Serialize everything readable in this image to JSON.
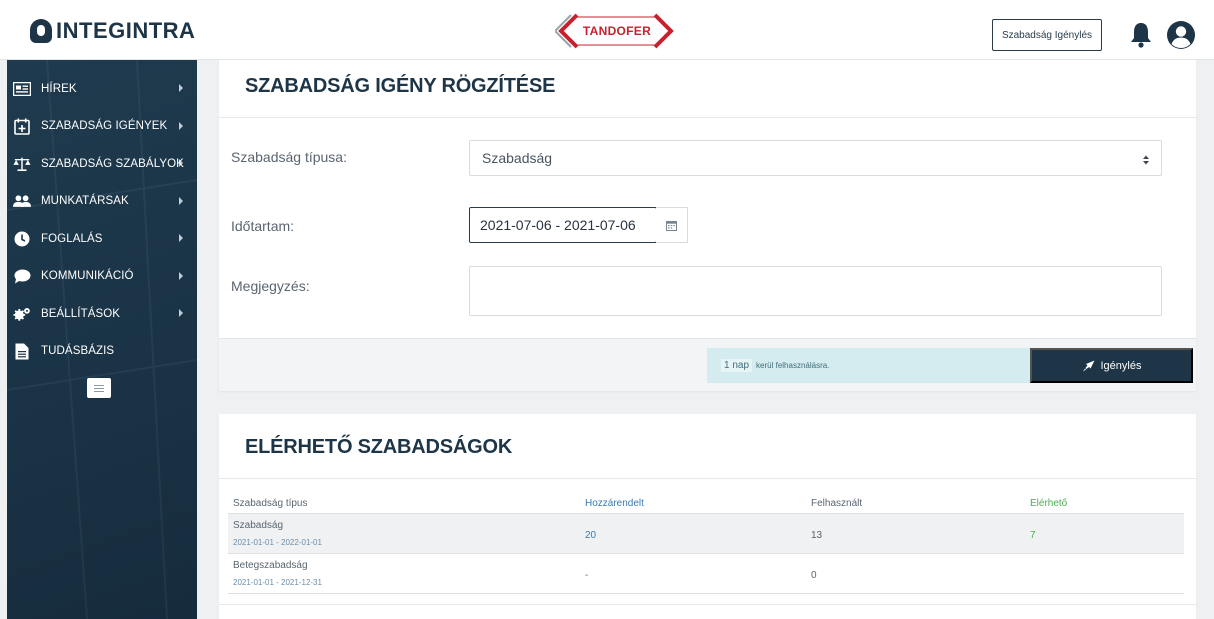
{
  "header": {
    "brand_left": "INTEGINTRA",
    "brand_center": "TANDOFER",
    "request_button": "Szabadság Igénylés",
    "icon_bell": "bell-icon",
    "icon_user": "user-avatar-icon"
  },
  "sidebar": {
    "items": [
      {
        "label": "HÍREK",
        "icon": "news-icon"
      },
      {
        "label": "SZABADSÁG IGÉNYEK",
        "icon": "calendar-plus-icon"
      },
      {
        "label": "SZABADSÁG SZABÁLYOK",
        "icon": "balance-scale-icon"
      },
      {
        "label": "MUNKATÁRSAK",
        "icon": "users-icon"
      },
      {
        "label": "FOGLALÁS",
        "icon": "clock-icon"
      },
      {
        "label": "KOMMUNIKÁCIÓ",
        "icon": "chat-icon"
      },
      {
        "label": "BEÁLLÍTÁSOK",
        "icon": "cogs-icon"
      },
      {
        "label": "TUDÁSBÁZIS",
        "icon": "document-icon"
      }
    ],
    "toggle_icon": "menu-toggle-icon"
  },
  "form": {
    "title": "SZABADSÁG IGÉNY RÖGZÍTÉSE",
    "type_label": "Szabadság típusa:",
    "type_value": "Szabadság",
    "duration_label": "Időtartam:",
    "duration_value": "2021-07-06 - 2021-07-06",
    "note_label": "Megjegyzés:",
    "note_value": "",
    "info_days": "1 nap",
    "info_text": "kerül felhasználásra.",
    "submit_label": "Igénylés",
    "submit_icon": "rocket-icon"
  },
  "available": {
    "title": "ELÉRHETŐ SZABADSÁGOK",
    "columns": [
      "Szabadság típus",
      "Hozzárendelt",
      "Felhasznált",
      "Elérhető"
    ],
    "rows": [
      {
        "type": "Szabadság",
        "period": "2021-01-01 - 2022-01-01",
        "assigned": "20",
        "used": "13",
        "available": "7"
      },
      {
        "type": "Betegszabadság",
        "period": "2021-01-01 - 2021-12-31",
        "assigned": "-",
        "used": "0",
        "available": ""
      }
    ]
  },
  "colors": {
    "brand_dark": "#1d3547",
    "accent_red": "#c8202e",
    "info_bg": "#d4ecef",
    "link_blue": "#3a7ab0",
    "available_green": "#4caf50"
  }
}
